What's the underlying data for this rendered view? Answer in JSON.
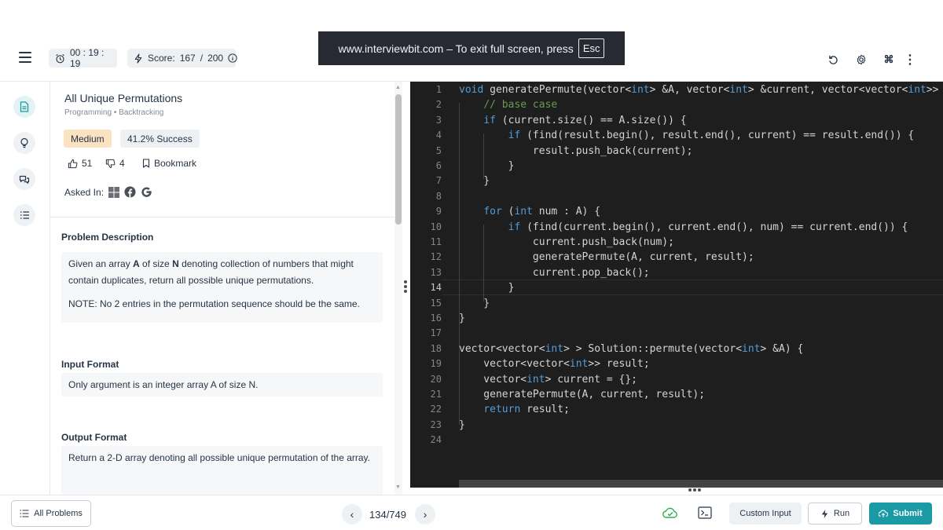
{
  "banner": {
    "text": "www.interviewbit.com – To exit full screen, press",
    "key": "Esc"
  },
  "header": {
    "timer": "00 : 19 : 19",
    "score_label": "Score:",
    "score_value": "167",
    "score_sep": "/",
    "score_max": "200"
  },
  "problem": {
    "title": "All Unique Permutations",
    "breadcrumb_1": "Programming",
    "breadcrumb_2": "Backtracking",
    "difficulty": "Medium",
    "success": "41.2% Success",
    "upvotes": "51",
    "downvotes": "4",
    "bookmark": "Bookmark",
    "asked_in": "Asked In:",
    "description_heading": "Problem Description",
    "description_p1_a": "Given an array ",
    "description_p1_b": "A",
    "description_p1_c": " of size ",
    "description_p1_d": "N",
    "description_p1_e": " denoting collection of numbers that might contain duplicates, return all possible unique permutations.",
    "description_p2": "NOTE: No 2 entries in the permutation sequence should be the same.",
    "input_heading": "Input Format",
    "input_text": "Only argument is an integer array A of size N.",
    "output_heading": "Output Format",
    "output_text": "Return a 2-D array denoting all possible unique permutation of the array."
  },
  "editor": {
    "current_line": 14,
    "lines": [
      "void generatePermute(vector<int> &A, vector<int> &current, vector<vector<int>>",
      "    // base case",
      "    if (current.size() == A.size()) {",
      "        if (find(result.begin(), result.end(), current) == result.end()) {",
      "            result.push_back(current);",
      "        }",
      "    }",
      "",
      "    for (int num : A) {",
      "        if (find(current.begin(), current.end(), num) == current.end()) {",
      "            current.push_back(num);",
      "            generatePermute(A, current, result);",
      "            current.pop_back();",
      "        }",
      "    }",
      "}",
      "",
      "vector<vector<int> > Solution::permute(vector<int> &A) {",
      "    vector<vector<int>> result;",
      "    vector<int> current = {};",
      "    generatePermute(A, current, result);",
      "    return result;",
      "}",
      ""
    ]
  },
  "footer": {
    "all_problems": "All Problems",
    "pager": "134/749",
    "custom_input": "Custom Input",
    "run": "Run",
    "submit": "Submit"
  },
  "colors": {
    "accent": "#1a9aa5",
    "editor_bg": "#1e1e1e",
    "keyword": "#569cd6",
    "comment": "#6a9955",
    "medium_tag": "#fbe2c0",
    "check_green": "#2eae4f"
  }
}
